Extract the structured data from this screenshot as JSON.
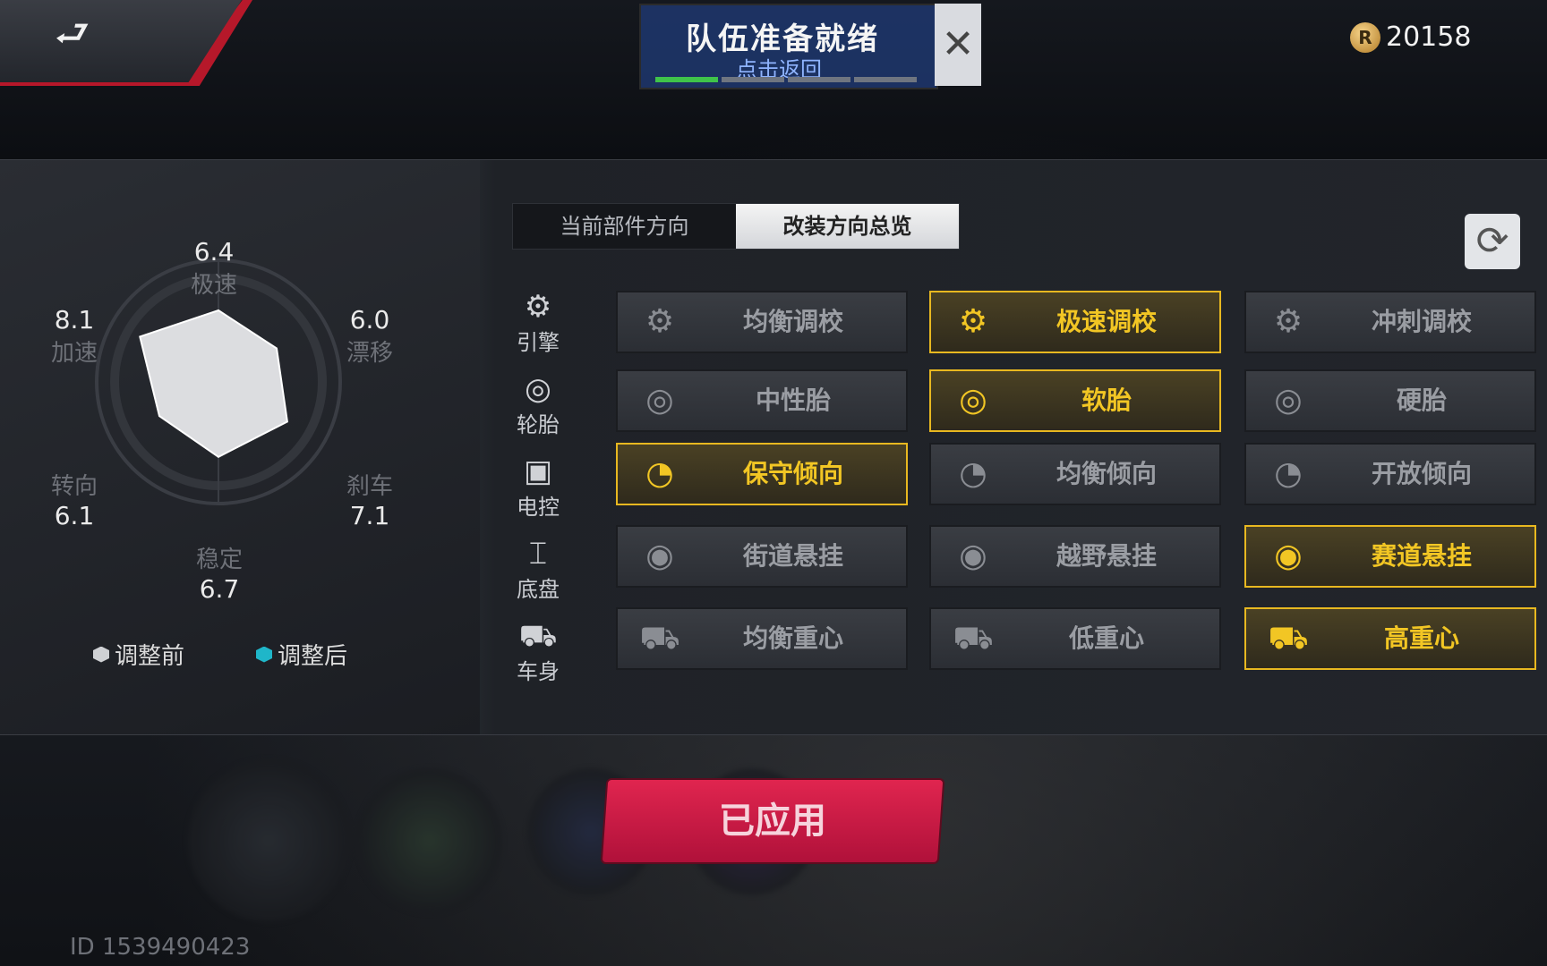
{
  "top": {
    "back_icon": "back-arrow-icon",
    "notice": {
      "title": "队伍准备就绪",
      "subtitle": "点击返回",
      "progress_segments_filled": 1,
      "progress_segments_total": 4
    },
    "coins": "20158"
  },
  "radar": {
    "stats": [
      {
        "label": "极速",
        "value": "6.4"
      },
      {
        "label": "漂移",
        "value": "6.0"
      },
      {
        "label": "刹车",
        "value": "7.1"
      },
      {
        "label": "稳定",
        "value": "6.7"
      },
      {
        "label": "转向",
        "value": "6.1"
      },
      {
        "label": "加速",
        "value": "8.1"
      }
    ],
    "legend_before": "调整前",
    "legend_after": "调整后",
    "colors": {
      "before": "#cfd1d4",
      "after": "#1fb6c9"
    }
  },
  "tabs": {
    "current": "当前部件方向",
    "overview": "改装方向总览"
  },
  "categories": [
    {
      "label": "引擎",
      "icon": "engine-icon"
    },
    {
      "label": "轮胎",
      "icon": "tire-icon"
    },
    {
      "label": "电控",
      "icon": "chip-icon"
    },
    {
      "label": "底盘",
      "icon": "chassis-icon"
    },
    {
      "label": "车身",
      "icon": "car-body-icon"
    }
  ],
  "options": [
    [
      "均衡调校",
      "极速调校",
      "冲刺调校"
    ],
    [
      "中性胎",
      "软胎",
      "硬胎"
    ],
    [
      "保守倾向",
      "均衡倾向",
      "开放倾向"
    ],
    [
      "街道悬挂",
      "越野悬挂",
      "赛道悬挂"
    ],
    [
      "均衡重心",
      "低重心",
      "高重心"
    ]
  ],
  "selected": [
    "极速调校",
    "软胎",
    "保守倾向",
    "赛道悬挂",
    "高重心"
  ],
  "apply_label": "已应用",
  "user_id": "ID 1539490423",
  "accent_color": "#e8b820"
}
